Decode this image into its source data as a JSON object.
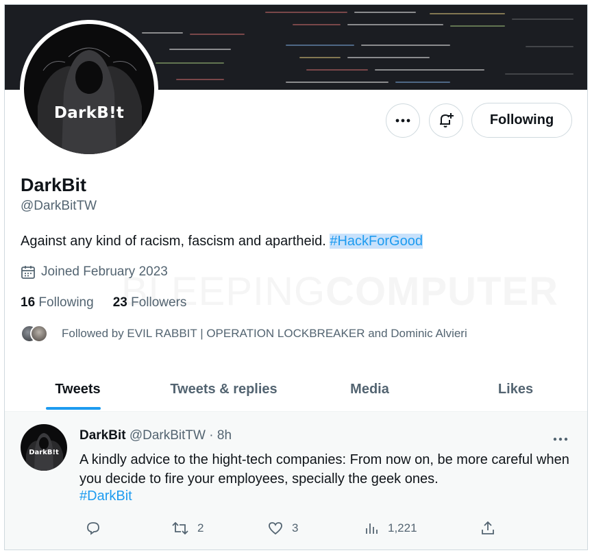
{
  "profile": {
    "avatar_text": "DarkB!t",
    "display_name": "DarkBit",
    "handle": "@DarkBitTW",
    "bio_text": "Against any kind of racism, fascism and apartheid. ",
    "bio_hashtag": "#HackForGood",
    "joined": "Joined February 2023",
    "following_count": "16",
    "following_label": "Following",
    "followers_count": "23",
    "followers_label": "Followers",
    "followed_by": "Followed by EVIL RABBIT | OPERATION LOCKBREAKER and Dominic Alvieri"
  },
  "actions": {
    "more_icon": "more-horizontal-icon",
    "notify_icon": "bell-plus-icon",
    "follow_label": "Following"
  },
  "watermark": {
    "part1": "BLEEPING",
    "part2": "COMPUTER"
  },
  "tabs": [
    {
      "label": "Tweets",
      "active": true
    },
    {
      "label": "Tweets & replies",
      "active": false
    },
    {
      "label": "Media",
      "active": false
    },
    {
      "label": "Likes",
      "active": false
    }
  ],
  "tweet": {
    "avatar_text": "DarkB!t",
    "name": "DarkBit",
    "handle": "@DarkBitTW",
    "separator": "·",
    "time": "8h",
    "text": "A kindly advice to the hight-tech companies: From now on, be more careful when you decide to fire your employees, specially the geek ones.",
    "hashtag": "#DarkBit",
    "replies": "",
    "retweets": "2",
    "likes": "3",
    "views": "1,221"
  },
  "colors": {
    "accent": "#1d9bf0",
    "secondary_text": "#536471",
    "primary_text": "#0f1419",
    "hashtag_highlight": "#c8e1fb"
  }
}
